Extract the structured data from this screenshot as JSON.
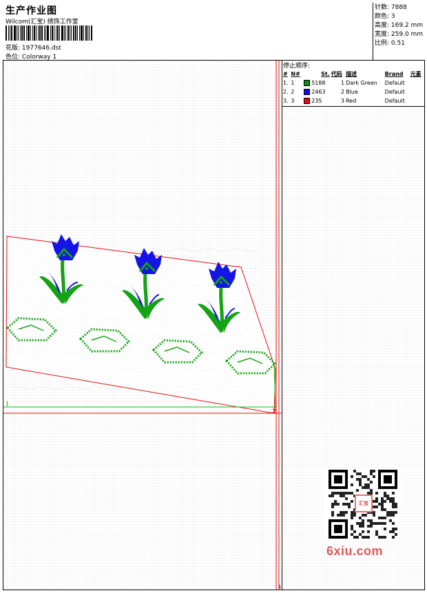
{
  "header": {
    "title": "生产作业图",
    "company": "Wilcom(汇宝) 绣饰工作室",
    "design_label": "花版:",
    "design_value": "1977646.dst",
    "colorway_label": "色位:",
    "colorway_value": "Colorway 1"
  },
  "stats": [
    {
      "label": "针数:",
      "value": "7888"
    },
    {
      "label": "颜色:",
      "value": "3"
    },
    {
      "label": "高度:",
      "value": "169.2 mm"
    },
    {
      "label": "宽度:",
      "value": "259.0 mm"
    },
    {
      "label": "比例:",
      "value": "0.51"
    }
  ],
  "stop_sequence": {
    "title": "停止顺序:",
    "columns": [
      "#",
      "N#",
      "St.",
      "代码",
      "描述",
      "Brand",
      "元素"
    ],
    "rows": [
      {
        "idx": "1.",
        "n": "1",
        "color": "#0a8a1a",
        "stitches": "5188",
        "code": "1",
        "desc": "Dark Green",
        "brand": "Default"
      },
      {
        "idx": "2.",
        "n": "2",
        "color": "#1010e0",
        "stitches": "2463",
        "code": "2",
        "desc": "Blue",
        "brand": "Default"
      },
      {
        "idx": "3.",
        "n": "3",
        "color": "#e01010",
        "stitches": "235",
        "code": "3",
        "desc": "Red",
        "brand": "Default"
      }
    ]
  },
  "canvas": {
    "start_marker": "1",
    "end_marker": "2",
    "bottom_marker": "1"
  },
  "colors": {
    "outline": "#e01010",
    "green": "#13a313",
    "blue": "#1414e6",
    "guide": "#00cc00"
  },
  "icons": [
    "barcode-icon",
    "qr-code-icon"
  ],
  "watermark": {
    "text": "6xiu.com",
    "qr_caption": "汇宝"
  }
}
